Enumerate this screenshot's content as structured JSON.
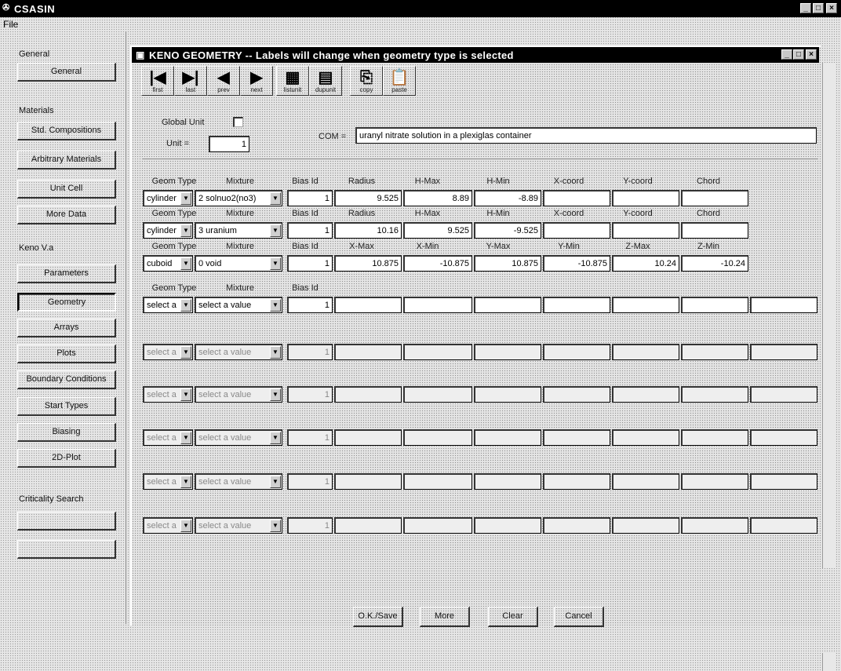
{
  "app": {
    "title": "CSASIN",
    "menu_file": "File"
  },
  "sidebar": {
    "sections": [
      {
        "heading": "General",
        "buttons": [
          {
            "label": "General",
            "state": "normal"
          }
        ]
      },
      {
        "heading": "Materials",
        "buttons": [
          {
            "label": "Std. Compositions",
            "state": "normal"
          },
          {
            "label": "Arbitrary Materials",
            "state": "normal"
          },
          {
            "label": "Unit Cell",
            "state": "normal"
          },
          {
            "label": "More Data",
            "state": "normal"
          }
        ]
      },
      {
        "heading": "Keno V.a",
        "buttons": [
          {
            "label": "Parameters",
            "state": "normal"
          },
          {
            "label": "Geometry",
            "state": "selected"
          },
          {
            "label": "Arrays",
            "state": "normal"
          },
          {
            "label": "Plots",
            "state": "normal"
          },
          {
            "label": "Boundary Conditions",
            "state": "normal"
          },
          {
            "label": "Start Types",
            "state": "normal"
          },
          {
            "label": "Biasing",
            "state": "normal"
          },
          {
            "label": "2D-Plot",
            "state": "normal"
          }
        ]
      },
      {
        "heading": "Criticality Search",
        "buttons": [
          {
            "label": "",
            "state": "disabled"
          },
          {
            "label": "",
            "state": "disabled"
          }
        ]
      }
    ]
  },
  "window": {
    "title": "KENO GEOMETRY -- Labels will change when geometry type is selected",
    "toolbar": [
      {
        "glyph": "|◀",
        "label": "first"
      },
      {
        "glyph": "▶|",
        "label": "last"
      },
      {
        "glyph": "◀",
        "label": "prev"
      },
      {
        "glyph": "▶",
        "label": "next"
      },
      {
        "glyph": "▦",
        "label": "listunit"
      },
      {
        "glyph": "▤",
        "label": "dupunit"
      },
      {
        "glyph": "⎘",
        "label": "copy"
      },
      {
        "glyph": "📋",
        "label": "paste"
      }
    ],
    "global_unit_label": "Global Unit",
    "unit_label": "Unit =",
    "unit_value": "1",
    "com_label": "COM =",
    "com_value": "uranyl nitrate solution in a plexiglas container",
    "rows": [
      {
        "geom": "cylinder",
        "mixture": "2 solnuo2(no3)",
        "headers": [
          "Geom Type",
          "Mixture",
          "Bias Id",
          "Radius",
          "H-Max",
          "H-Min",
          "X-coord",
          "Y-coord",
          "Chord"
        ],
        "values": [
          "1",
          "9.525",
          "8.89",
          "-8.89",
          "",
          "",
          ""
        ],
        "state": "active"
      },
      {
        "geom": "cylinder",
        "mixture": "3 uranium",
        "headers": [
          "Geom Type",
          "Mixture",
          "Bias Id",
          "Radius",
          "H-Max",
          "H-Min",
          "X-coord",
          "Y-coord",
          "Chord"
        ],
        "values": [
          "1",
          "10.16",
          "9.525",
          "-9.525",
          "",
          "",
          ""
        ],
        "state": "active"
      },
      {
        "geom": "cuboid",
        "mixture": "0 void",
        "headers": [
          "Geom Type",
          "Mixture",
          "Bias Id",
          "X-Max",
          "X-Min",
          "Y-Max",
          "Y-Min",
          "Z-Max",
          "Z-Min"
        ],
        "values": [
          "1",
          "10.875",
          "-10.875",
          "10.875",
          "-10.875",
          "10.24",
          "-10.24"
        ],
        "state": "active"
      },
      {
        "geom": "select a",
        "mixture": "select a value",
        "headers": [
          "Geom Type",
          "Mixture",
          "Bias Id",
          "",
          "",
          "",
          "",
          "",
          ""
        ],
        "values": [
          "1",
          "",
          "",
          "",
          "",
          "",
          "",
          ""
        ],
        "state": "active"
      },
      {
        "geom": "select a",
        "mixture": "select a value",
        "headers": [
          "",
          "",
          "",
          "",
          "",
          "",
          "",
          "",
          ""
        ],
        "values": [
          "1",
          "",
          "",
          "",
          "",
          "",
          "",
          ""
        ],
        "state": "dim"
      },
      {
        "geom": "select a",
        "mixture": "select a value",
        "headers": [
          "",
          "",
          "",
          "",
          "",
          "",
          "",
          "",
          ""
        ],
        "values": [
          "1",
          "",
          "",
          "",
          "",
          "",
          "",
          ""
        ],
        "state": "dim"
      },
      {
        "geom": "select a",
        "mixture": "select a value",
        "headers": [
          "",
          "",
          "",
          "",
          "",
          "",
          "",
          "",
          ""
        ],
        "values": [
          "1",
          "",
          "",
          "",
          "",
          "",
          "",
          ""
        ],
        "state": "dim"
      },
      {
        "geom": "select a",
        "mixture": "select a value",
        "headers": [
          "",
          "",
          "",
          "",
          "",
          "",
          "",
          "",
          ""
        ],
        "values": [
          "1",
          "",
          "",
          "",
          "",
          "",
          "",
          ""
        ],
        "state": "dim"
      },
      {
        "geom": "select a",
        "mixture": "select a value",
        "headers": [
          "",
          "",
          "",
          "",
          "",
          "",
          "",
          "",
          ""
        ],
        "values": [
          "1",
          "",
          "",
          "",
          "",
          "",
          "",
          ""
        ],
        "state": "dim"
      }
    ],
    "actions": {
      "ok": "O.K./Save",
      "more": "More",
      "clear": "Clear",
      "cancel": "Cancel"
    }
  }
}
